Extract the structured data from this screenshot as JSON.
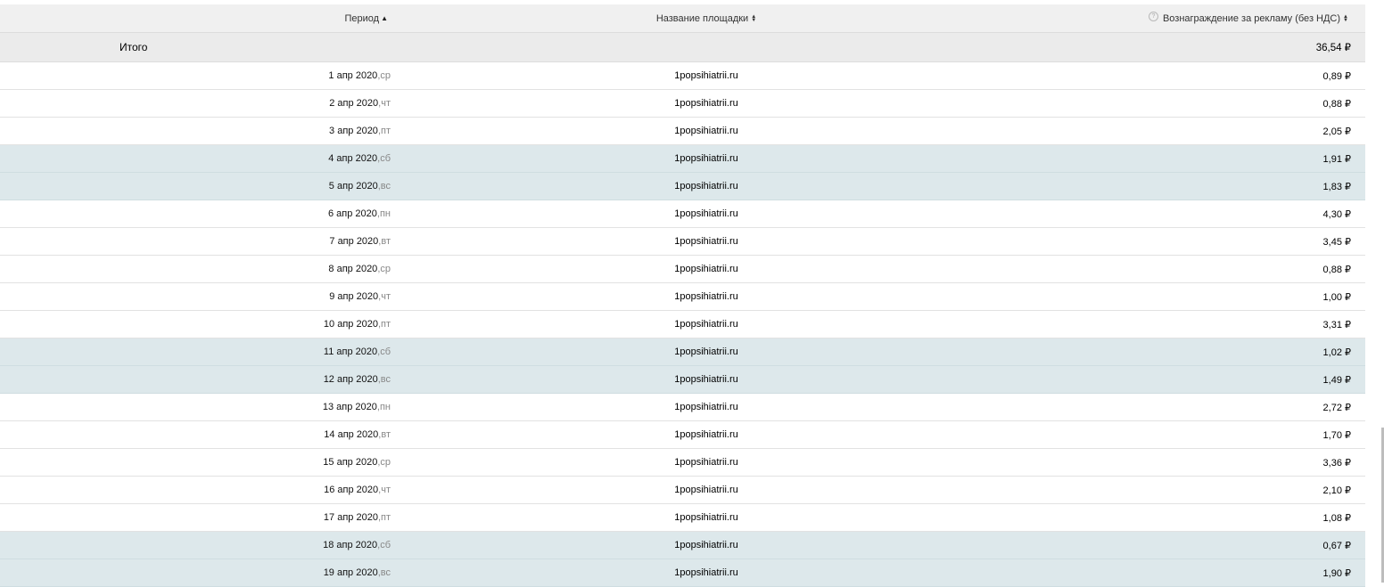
{
  "table": {
    "headers": {
      "period": "Период",
      "site": "Название площадки",
      "reward": "Вознаграждение за рекламу (без НДС)"
    },
    "sort_icons": {
      "period": "sort-asc-icon",
      "site": "sort-both-icon",
      "reward": "sort-both-icon"
    },
    "total": {
      "label": "Итого",
      "reward": "36,54 ₽"
    },
    "weekend_bg": "#dde8eb",
    "rows": [
      {
        "date": "1 апр 2020",
        "sep": ", ",
        "dow": "ср",
        "site": "1popsihiatrii.ru",
        "reward": "0,89 ₽",
        "weekend": false
      },
      {
        "date": "2 апр 2020",
        "sep": ", ",
        "dow": "чт",
        "site": "1popsihiatrii.ru",
        "reward": "0,88 ₽",
        "weekend": false
      },
      {
        "date": "3 апр 2020",
        "sep": ", ",
        "dow": "пт",
        "site": "1popsihiatrii.ru",
        "reward": "2,05 ₽",
        "weekend": false
      },
      {
        "date": "4 апр 2020",
        "sep": ", ",
        "dow": "сб",
        "site": "1popsihiatrii.ru",
        "reward": "1,91 ₽",
        "weekend": true
      },
      {
        "date": "5 апр 2020",
        "sep": ", ",
        "dow": "вс",
        "site": "1popsihiatrii.ru",
        "reward": "1,83 ₽",
        "weekend": true
      },
      {
        "date": "6 апр 2020",
        "sep": ", ",
        "dow": "пн",
        "site": "1popsihiatrii.ru",
        "reward": "4,30 ₽",
        "weekend": false
      },
      {
        "date": "7 апр 2020",
        "sep": ", ",
        "dow": "вт",
        "site": "1popsihiatrii.ru",
        "reward": "3,45 ₽",
        "weekend": false
      },
      {
        "date": "8 апр 2020",
        "sep": ", ",
        "dow": "ср",
        "site": "1popsihiatrii.ru",
        "reward": "0,88 ₽",
        "weekend": false
      },
      {
        "date": "9 апр 2020",
        "sep": ", ",
        "dow": "чт",
        "site": "1popsihiatrii.ru",
        "reward": "1,00 ₽",
        "weekend": false
      },
      {
        "date": "10 апр 2020",
        "sep": ", ",
        "dow": "пт",
        "site": "1popsihiatrii.ru",
        "reward": "3,31 ₽",
        "weekend": false
      },
      {
        "date": "11 апр 2020",
        "sep": ", ",
        "dow": "сб",
        "site": "1popsihiatrii.ru",
        "reward": "1,02 ₽",
        "weekend": true
      },
      {
        "date": "12 апр 2020",
        "sep": ", ",
        "dow": "вс",
        "site": "1popsihiatrii.ru",
        "reward": "1,49 ₽",
        "weekend": true
      },
      {
        "date": "13 апр 2020",
        "sep": ", ",
        "dow": "пн",
        "site": "1popsihiatrii.ru",
        "reward": "2,72 ₽",
        "weekend": false
      },
      {
        "date": "14 апр 2020",
        "sep": ", ",
        "dow": "вт",
        "site": "1popsihiatrii.ru",
        "reward": "1,70 ₽",
        "weekend": false
      },
      {
        "date": "15 апр 2020",
        "sep": ", ",
        "dow": "ср",
        "site": "1popsihiatrii.ru",
        "reward": "3,36 ₽",
        "weekend": false
      },
      {
        "date": "16 апр 2020",
        "sep": ", ",
        "dow": "чт",
        "site": "1popsihiatrii.ru",
        "reward": "2,10 ₽",
        "weekend": false
      },
      {
        "date": "17 апр 2020",
        "sep": ", ",
        "dow": "пт",
        "site": "1popsihiatrii.ru",
        "reward": "1,08 ₽",
        "weekend": false
      },
      {
        "date": "18 апр 2020",
        "sep": ", ",
        "dow": "сб",
        "site": "1popsihiatrii.ru",
        "reward": "0,67 ₽",
        "weekend": true
      },
      {
        "date": "19 апр 2020",
        "sep": ", ",
        "dow": "вс",
        "site": "1popsihiatrii.ru",
        "reward": "1,90 ₽",
        "weekend": true
      }
    ]
  }
}
